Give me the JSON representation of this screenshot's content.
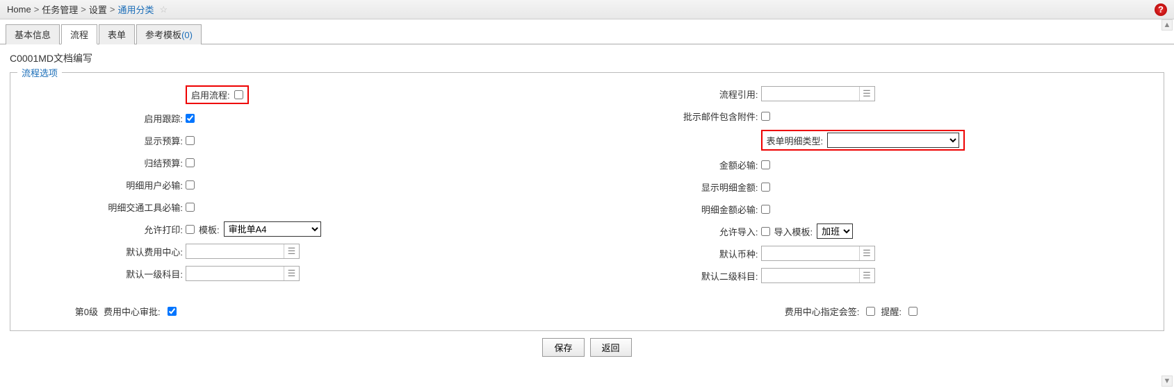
{
  "breadcrumb": {
    "home": "Home",
    "task_mgmt": "任务管理",
    "settings": "设置",
    "current": "通用分类"
  },
  "tabs": {
    "basic": "基本信息",
    "process": "流程",
    "form": "表单",
    "ref_template": "参考模板",
    "ref_template_count": "(0)"
  },
  "page_title": "C0001MD文档编写",
  "fieldset_legend": "流程选项",
  "left": {
    "enable_process": "启用流程:",
    "enable_tracking": "启用跟踪:",
    "show_budget": "显示预算:",
    "summarize_budget": "归结预算:",
    "detail_user_required": "明细用户必输:",
    "detail_vehicle_required": "明细交通工具必输:",
    "allow_print": "允许打印:",
    "template_label": "模板:",
    "template_value": "审批单A4",
    "default_cost_center": "默认费用中心:",
    "default_level1_subject": "默认一级科目:"
  },
  "right": {
    "process_ref": "流程引用:",
    "approval_mail_attachment": "批示邮件包含附件:",
    "form_detail_type": "表单明细类型:",
    "amount_required": "金额必输:",
    "show_detail_amount": "显示明细金额:",
    "detail_amount_required": "明细金额必输:",
    "allow_import": "允许导入:",
    "import_template_label": "导入模板:",
    "import_template_value": "加班",
    "default_currency": "默认币种:",
    "default_level2_subject": "默认二级科目:"
  },
  "level": {
    "level_label": "第0级",
    "cost_center_approve": "费用中心审批:",
    "cost_center_assign": "费用中心指定会签:",
    "remind": "提醒:"
  },
  "buttons": {
    "save": "保存",
    "back": "返回"
  },
  "icons": {
    "lookup_glyph": "☰"
  }
}
